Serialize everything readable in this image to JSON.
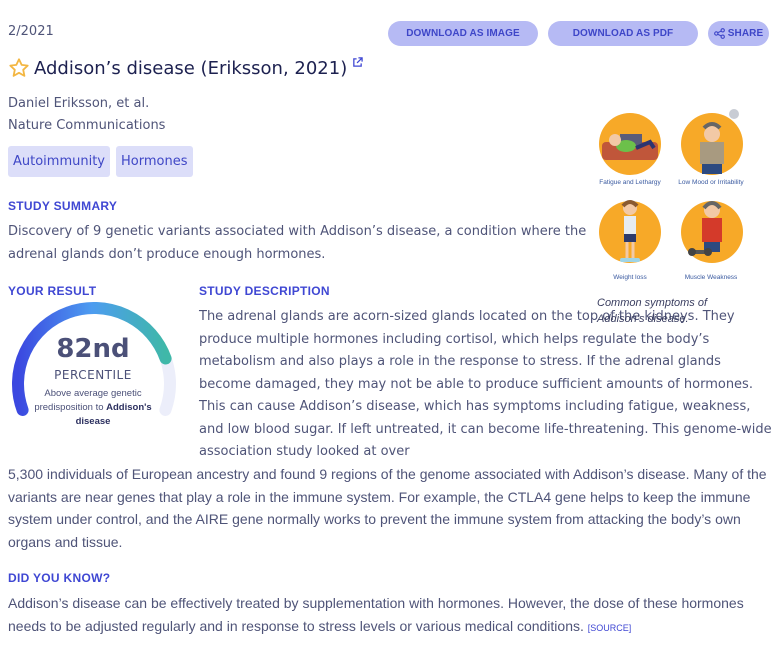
{
  "header": {
    "date": "2/2021",
    "title": "Addison’s disease (Eriksson, 2021)",
    "icons": {
      "favorite": "star-outline-icon",
      "external": "external-link-icon",
      "share": "share-icon"
    }
  },
  "actions": {
    "download_image": "DOWNLOAD AS IMAGE",
    "download_pdf": "DOWNLOAD AS PDF",
    "share": "SHARE"
  },
  "study": {
    "authors": "Daniel Eriksson, et al.",
    "journal": "Nature Communications",
    "tags": [
      "Autoimmunity",
      "Hormones"
    ]
  },
  "summary": {
    "heading": "STUDY SUMMARY",
    "text": "Discovery of 9 genetic variants associated with Addison’s disease, a condition where the adrenal glands don’t produce enough hormones."
  },
  "result": {
    "heading": "YOUR RESULT",
    "percentile_value": 82,
    "value_label": "82nd",
    "unit_label": "PERCENTILE",
    "desc_prefix": "Above average genetic predisposition to ",
    "desc_bold": "Addison's disease"
  },
  "description": {
    "heading": "STUDY DESCRIPTION",
    "text_wrapped": "The adrenal glands are acorn-sized glands located on the top of the kidneys. They produce multiple hormones including cortisol, which helps regulate the body’s metabolism and also plays a role in the response to stress. If the adrenal glands become damaged, they may not be able to produce sufficient amounts of hormones. This can cause Addison’s disease, which has symptoms including fatigue, weakness, and low blood sugar. If left untreated, it can become life-threatening. This genome-wide association study looked at over",
    "text_full": "5,300 individuals of European ancestry and found 9 regions of the genome associated with Addison’s disease. Many of the variants are near genes that play a role in the immune system. For example, the CTLA4 gene helps to keep the immune system under control, and the AIRE gene normally works to prevent the immune system from attacking the body’s own organs and tissue."
  },
  "figure": {
    "symptoms": [
      "Fatigue and Lethargy",
      "Low Mood or Irritability",
      "Weight loss",
      "Muscle Weakness"
    ],
    "caption": "Common symptoms of Addison’s disease."
  },
  "did_you_know": {
    "heading": "DID YOU KNOW?",
    "text": "Addison’s disease can be effectively treated by supplementation with hormones. However, the dose of these hormones needs to be adjusted regularly and in response to stress levels or various medical conditions. ",
    "source_label": "[SOURCE]"
  },
  "colors": {
    "accent": "#3f47d3",
    "button_bg": "#b6baf4",
    "tag_bg": "#dcdef9",
    "gauge_start": "#3b48e0",
    "gauge_mid": "#4d9cf0",
    "gauge_end": "#3fb8a8",
    "gauge_track": "#eceefa",
    "illustration_bg": "#f7a928"
  }
}
